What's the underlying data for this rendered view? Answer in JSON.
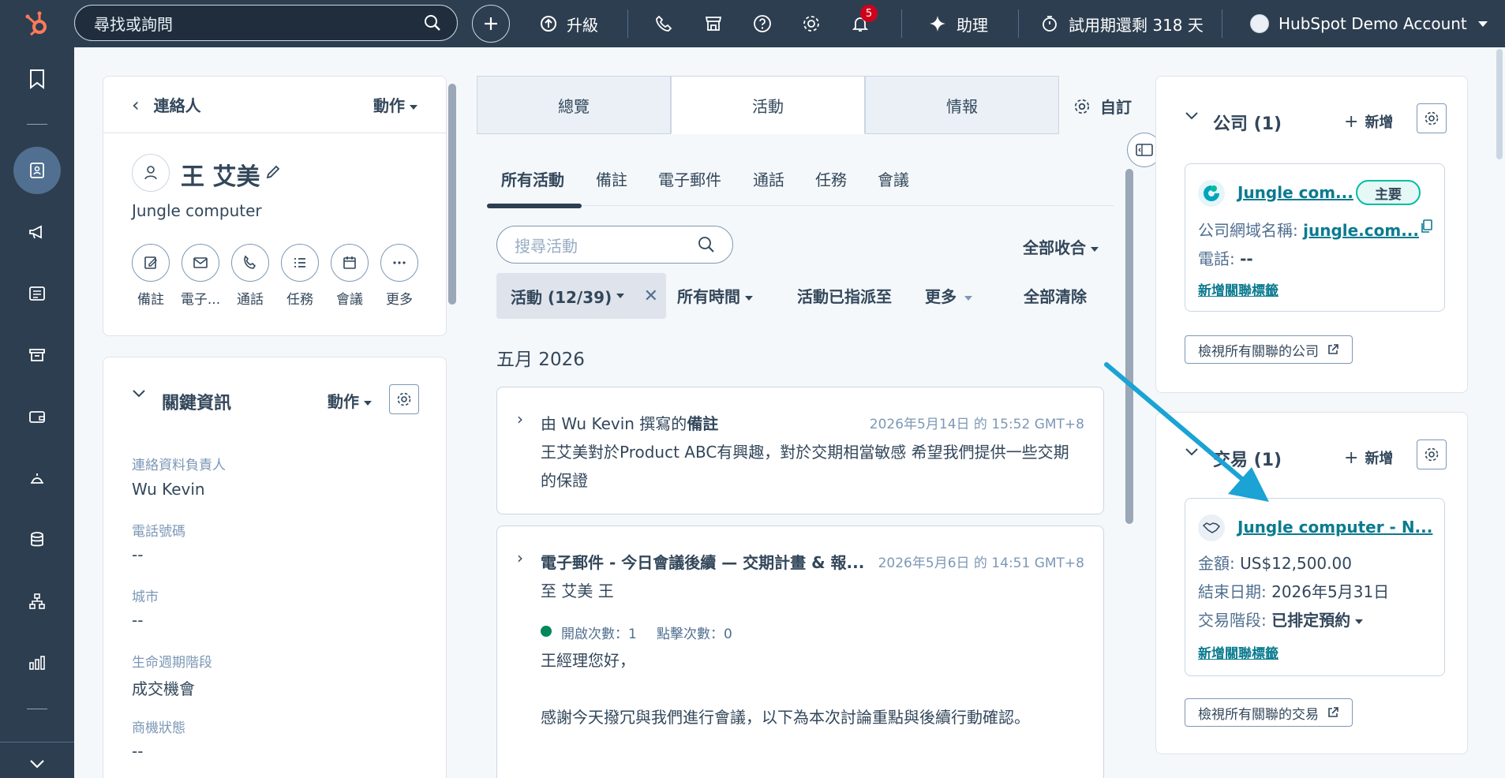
{
  "topbar": {
    "search_placeholder": "尋找或詢問",
    "upgrade_label": "升級",
    "notification_count": "5",
    "assistant_label": "助理",
    "trial_label": "試用期還剩 318 天",
    "account_label": "HubSpot Demo Account",
    "icons": [
      "hubspot-logo",
      "search-icon",
      "plus-icon",
      "upgrade-icon",
      "phone-icon",
      "marketplace-icon",
      "help-icon",
      "settings-icon",
      "bell-icon",
      "sparkle-icon",
      "timer-icon",
      "account-avatar"
    ]
  },
  "leftnav": {
    "icons": [
      "bookmark-icon",
      "contacts-icon",
      "marketing-icon",
      "content-icon",
      "commerce-icon",
      "wallet-icon",
      "service-icon",
      "data-icon",
      "automation-icon",
      "reports-icon",
      "expand-icon"
    ]
  },
  "contact": {
    "back_label": "連絡人",
    "action_label": "動作",
    "name": "王 艾美",
    "company": "Jungle computer",
    "actions": [
      {
        "label": "備註",
        "icon": "note-icon"
      },
      {
        "label": "電子...",
        "icon": "email-icon"
      },
      {
        "label": "通話",
        "icon": "call-icon"
      },
      {
        "label": "任務",
        "icon": "task-icon"
      },
      {
        "label": "會議",
        "icon": "meeting-icon"
      },
      {
        "label": "更多",
        "icon": "more-icon"
      }
    ]
  },
  "key_info": {
    "title": "關鍵資訊",
    "action_label": "動作",
    "fields": [
      {
        "label": "連絡資料負責人",
        "value": "Wu Kevin"
      },
      {
        "label": "電話號碼",
        "value": "--"
      },
      {
        "label": "城市",
        "value": "--"
      },
      {
        "label": "生命週期階段",
        "value": "成交機會"
      },
      {
        "label": "商機狀態",
        "value": "--"
      }
    ]
  },
  "tabs": [
    {
      "label": "總覽",
      "active": false
    },
    {
      "label": "活動",
      "active": true
    },
    {
      "label": "情報",
      "active": false
    }
  ],
  "customize_label": "自訂",
  "subtabs": [
    "所有活動",
    "備註",
    "電子郵件",
    "通話",
    "任務",
    "會議"
  ],
  "activity_search_placeholder": "搜尋活動",
  "collapse_all_label": "全部收合",
  "filters": {
    "chip": "活動 (12/39)",
    "time": "所有時間",
    "assigned": "活動已指派至",
    "more": "更多",
    "clear": "全部清除"
  },
  "month_label": "五月 2026",
  "activities": {
    "note": {
      "prefix": "由 Wu Kevin 撰寫的",
      "type": "備註",
      "time": "2026年5月14日 的 15:52 GMT+8",
      "body": "王艾美對於Product ABC有興趣，對於交期相當敏感 希望我們提供一些交期的保證"
    },
    "email": {
      "title": "電子郵件 - 今日會議後續 — 交期計畫 & 報...",
      "time": "2026年5月6日 的 14:51 GMT+8",
      "to": "至 艾美 王",
      "opens": "開啟次數：1",
      "clicks": "點擊次數：0",
      "greeting": "王經理您好，",
      "body": "感謝今天撥冗與我們進行會議，以下為本次討論重點與後續行動確認。"
    }
  },
  "companies": {
    "title": "公司 (1)",
    "add_label": "新增",
    "name": "Jungle com...",
    "primary_label": "主要",
    "domain_label": "公司網域名稱:",
    "domain_value": "jungle.com...",
    "phone_label": "電話:",
    "phone_value": "--",
    "add_tag_label": "新增關聯標籤",
    "view_all_label": "檢視所有關聯的公司"
  },
  "deals": {
    "title": "交易 (1)",
    "add_label": "新增",
    "name": "Jungle computer - N...",
    "amount_label": "金額:",
    "amount_value": "US$12,500.00",
    "close_label": "結束日期:",
    "close_value": "2026年5月31日",
    "stage_label": "交易階段:",
    "stage_value": "已排定預約",
    "add_tag_label": "新增關聯標籤",
    "view_all_label": "檢視所有關聯的交易"
  },
  "colors": {
    "topbar": "#2d3e50",
    "link": "#0b7b8f",
    "arrow": "#1aa3d4",
    "badge": "#d0021b",
    "open_dot": "#00875a"
  }
}
